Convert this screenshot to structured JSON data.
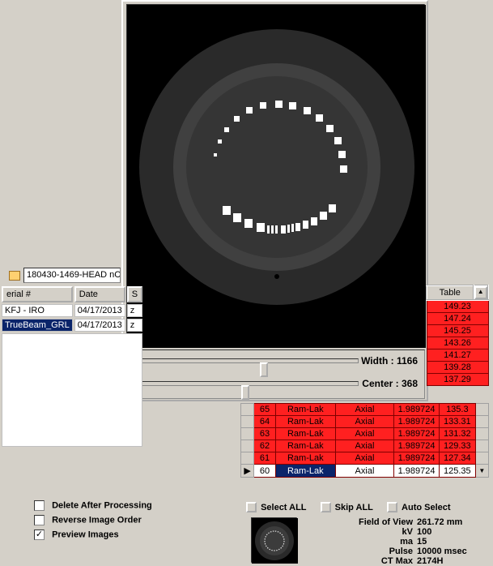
{
  "preview": {
    "width_label": "Width : 1166",
    "center_label": "Center : 368"
  },
  "path": "180430-1469-HEAD nC",
  "patient_table": {
    "cols": [
      "erial #",
      "Date",
      "S"
    ],
    "rows": [
      [
        "KFJ - IRO",
        "04/17/2013",
        "z"
      ],
      [
        "TrueBeam_GRL",
        "04/17/2013",
        "z"
      ]
    ]
  },
  "right_small": {
    "header": "Table",
    "vals": [
      "149.23",
      "147.24",
      "145.25",
      "143.26",
      "141.27",
      "139.28",
      "137.29"
    ]
  },
  "lower_table": {
    "red_rows": [
      [
        "65",
        "Ram-Lak",
        "Axial",
        "1.989724",
        "135.3"
      ],
      [
        "64",
        "Ram-Lak",
        "Axial",
        "1.989724",
        "133.31"
      ],
      [
        "63",
        "Ram-Lak",
        "Axial",
        "1.989724",
        "131.32"
      ],
      [
        "62",
        "Ram-Lak",
        "Axial",
        "1.989724",
        "129.33"
      ],
      [
        "61",
        "Ram-Lak",
        "Axial",
        "1.989724",
        "127.34"
      ]
    ],
    "sel_row": [
      "60",
      "Ram-Lak",
      "Axial",
      "1.989724",
      "125.35"
    ]
  },
  "buttons": {
    "select_all": "Select ALL",
    "skip_all": "Skip ALL",
    "auto_select": "Auto Select"
  },
  "checkboxes": {
    "delete_after": "Delete After Processing",
    "reverse_order": "Reverse Image Order",
    "preview_images": "Preview Images"
  },
  "info": {
    "fov_label": "Field of View",
    "fov_val": "261.72 mm",
    "kv_label": "kV",
    "kv_val": "100",
    "ma_label": "ma",
    "ma_val": "15",
    "pulse_label": "Pulse",
    "pulse_val": "10000 msec",
    "ctmax_label": "CT Max",
    "ctmax_val": "2174H"
  }
}
